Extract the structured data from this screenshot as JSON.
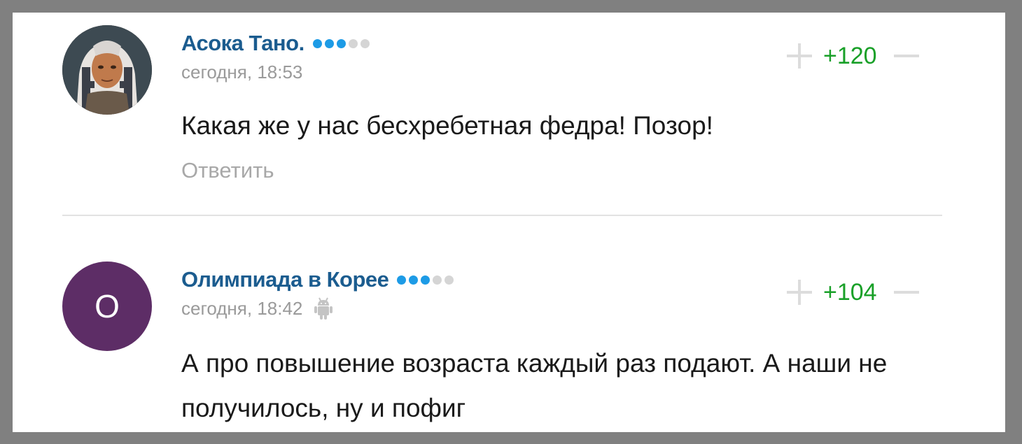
{
  "comments": [
    {
      "author": "Асока Тано.",
      "avatar_icon": "user-photo-avatar",
      "rank": {
        "filled": 3,
        "total": 5
      },
      "timestamp": "сегодня, 18:53",
      "device_icon": null,
      "score": "+120",
      "text": "Какая же у нас бесхребетная федра! Позор!",
      "reply_label": "Ответить"
    },
    {
      "author": "Олимпиада в Корее",
      "avatar_letter": "О",
      "rank": {
        "filled": 3,
        "total": 5
      },
      "timestamp": "сегодня, 18:42",
      "device_icon": "android-icon",
      "score": "+104",
      "text": "А про повышение возраста каждый раз подают. А наши не получилось, ну и пофиг"
    }
  ],
  "colors": {
    "author": "#1b5c8f",
    "score_positive": "#19a028",
    "rank_on": "#1d9be6",
    "rank_off": "#d5d5d5",
    "avatar_letter_bg": "#5d2d66"
  }
}
